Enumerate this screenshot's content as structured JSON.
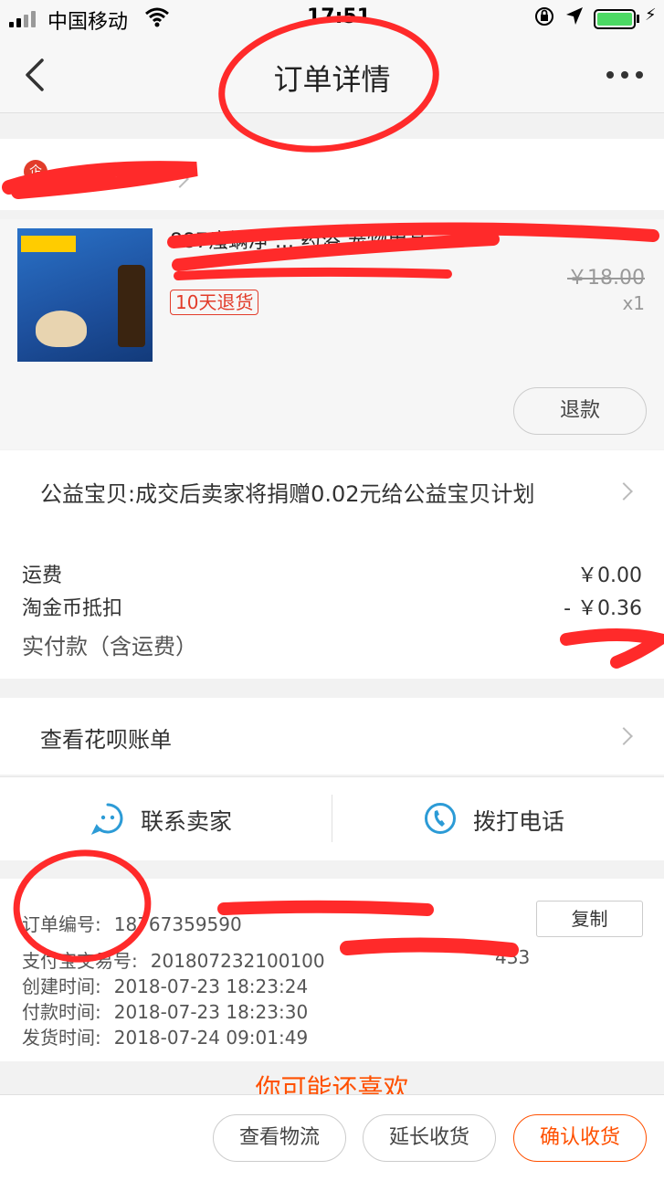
{
  "status_bar": {
    "carrier": "中国移动",
    "time": "17:51"
  },
  "navbar": {
    "title": "订单详情"
  },
  "shop": {
    "badge": "企"
  },
  "item": {
    "name": "887瘙螨净 ... 药浴 宠物用品",
    "original_price": "￥18.00",
    "quantity": "x1",
    "return_tag": "10天退货",
    "refund_label": "退款"
  },
  "charity": {
    "text": "公益宝贝:成交后卖家将捐赠0.02元给公益宝贝计划"
  },
  "fees": {
    "shipping_label": "运费",
    "shipping_value": "￥0.00",
    "coin_label": "淘金币抵扣",
    "coin_value": "- ￥0.36",
    "paid_label": "实付款（含运费）"
  },
  "huabei": {
    "label": "查看花呗账单"
  },
  "contact": {
    "seller_label": "联系卖家",
    "phone_label": "拨打电话"
  },
  "order_info": {
    "order_no_label": "订单编号:",
    "order_no_value": "18767359590",
    "alipay_label": "支付宝交易号:",
    "alipay_value": "201807232100100",
    "alipay_suffix": "433",
    "created_label": "创建时间:",
    "created_value": "2018-07-23 18:23:24",
    "paid_label": "付款时间:",
    "paid_value": "2018-07-23 18:23:30",
    "shipped_label": "发货时间:",
    "shipped_value": "2018-07-24 09:01:49",
    "copy_label": "复制"
  },
  "guess": {
    "label": "你可能还喜欢"
  },
  "footer": {
    "logistics_label": "查看物流",
    "extend_label": "延长收货",
    "confirm_label": "确认收货"
  },
  "colors": {
    "accent": "#ff5000",
    "tag_red": "#e23c2a",
    "battery": "#4cd964"
  }
}
